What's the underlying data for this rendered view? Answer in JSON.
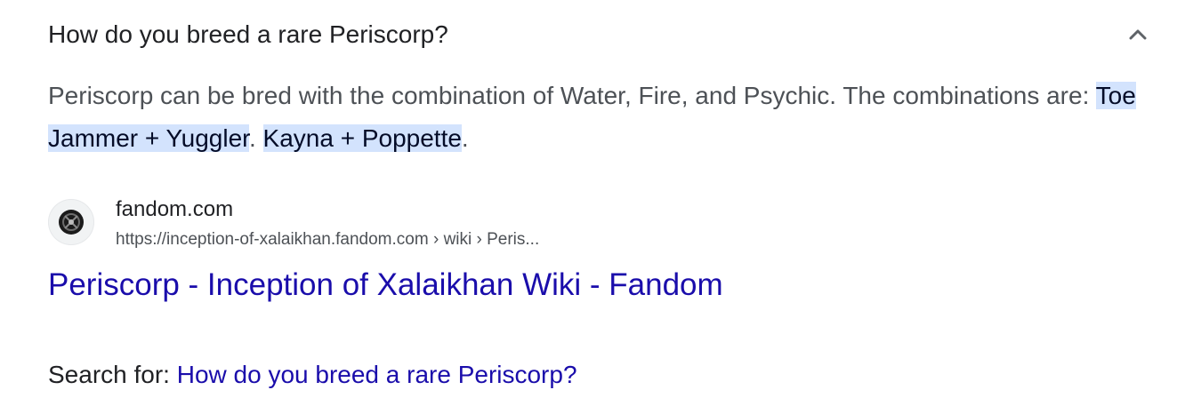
{
  "question": {
    "text": "How do you breed a rare Periscorp?",
    "toggle_icon": "chevron-up-icon"
  },
  "answer": {
    "intro": "Periscorp can be bred with the combination of Water, Fire, and Psychic. The combinations are: ",
    "combo1": "Toe Jammer + Yuggler",
    "sep1": ". ",
    "combo2": "Kayna + Poppette",
    "sep2": "."
  },
  "source": {
    "favicon_icon": "fandom-logo-icon",
    "site_name": "fandom.com",
    "url": "https://inception-of-xalaikhan.fandom.com › wiki › Peris..."
  },
  "result": {
    "title": "Periscorp - Inception of Xalaikhan Wiki - Fandom"
  },
  "search_for": {
    "label": "Search for: ",
    "query": "How do you breed a rare Periscorp?"
  },
  "colors": {
    "link": "#1a0dab",
    "highlight": "#d3e3fd",
    "body_text": "#4d5156",
    "heading_text": "#202124"
  }
}
